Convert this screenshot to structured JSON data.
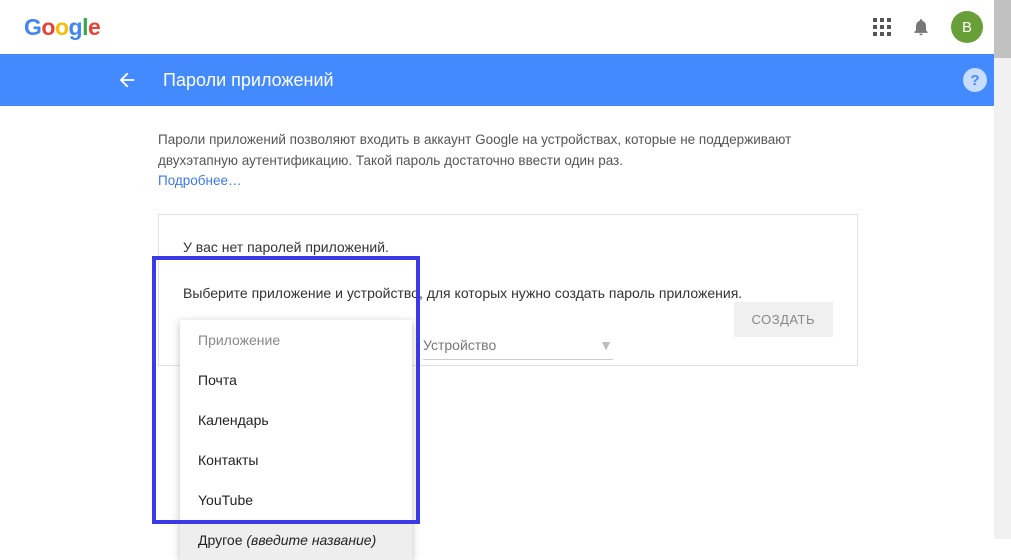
{
  "topbar": {
    "logo_letters": [
      "G",
      "o",
      "o",
      "g",
      "l",
      "e"
    ],
    "avatar_letter": "В"
  },
  "bluebar": {
    "title": "Пароли приложений",
    "help": "?"
  },
  "content": {
    "description": "Пароли приложений позволяют входить в аккаунт Google на устройствах, которые не поддерживают двухэтапную аутентификацию. Такой пароль достаточно ввести один раз.",
    "learn_more": "Подробнее…"
  },
  "card": {
    "line1": "У вас нет паролей приложений.",
    "line2": "Выберите приложение и устройство, для которых нужно создать пароль приложения.",
    "device_label": "Устройство",
    "create_btn": "СОЗДАТЬ"
  },
  "dropdown": {
    "header": "Приложение",
    "items": [
      "Почта",
      "Календарь",
      "Контакты",
      "YouTube"
    ],
    "other_prefix": "Другое ",
    "other_hint": "(введите название)"
  }
}
